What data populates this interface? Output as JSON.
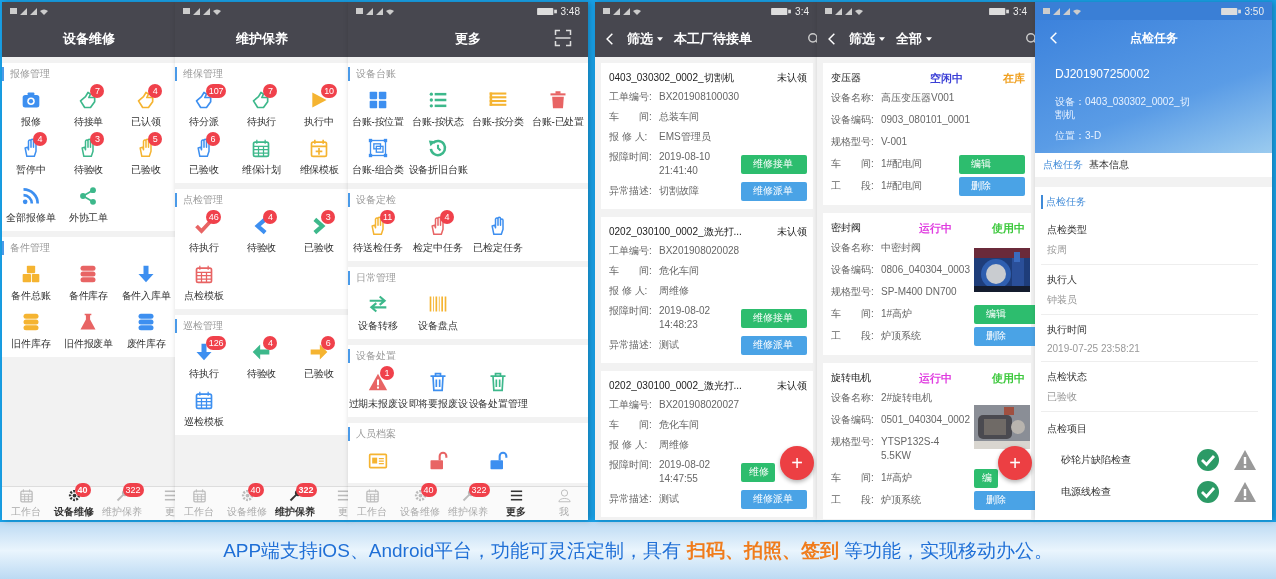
{
  "phones": [
    {
      "kind": "menu",
      "title": "设备维修",
      "sections": [
        {
          "title": "报修管理",
          "items": [
            {
              "label": "报修"
            },
            {
              "label": "待接单",
              "badge": "7"
            },
            {
              "label": "已认领",
              "badge": "4"
            },
            {
              "label": "暂停中",
              "badge": "4"
            },
            {
              "label": "待验收",
              "badge": "3"
            },
            {
              "label": "已验收",
              "badge": "5"
            },
            {
              "label": "全部报修单"
            },
            {
              "label": "外协工单"
            }
          ]
        },
        {
          "title": "备件管理",
          "items": [
            {
              "label": "备件总账"
            },
            {
              "label": "备件库存"
            },
            {
              "label": "备件入库单"
            },
            {
              "label": "旧件库存"
            },
            {
              "label": "旧件报废单"
            },
            {
              "label": "废件库存"
            }
          ]
        }
      ],
      "tabs": [
        {
          "label": "工作台",
          "selected": false
        },
        {
          "label": "设备维修",
          "badge": "40",
          "selected": true
        },
        {
          "label": "维护保养",
          "badge": "322",
          "selected": false
        },
        {
          "label": "更",
          "selected": false
        }
      ]
    },
    {
      "kind": "menu",
      "title": "维护保养",
      "sections": [
        {
          "title": "维保管理",
          "items": [
            {
              "label": "待分派",
              "badge": "107"
            },
            {
              "label": "待执行",
              "badge": "7"
            },
            {
              "label": "执行中",
              "badge": "10"
            },
            {
              "label": "已验收",
              "badge": "6"
            },
            {
              "label": "维保计划"
            },
            {
              "label": "维保模板"
            }
          ]
        },
        {
          "title": "点检管理",
          "items": [
            {
              "label": "待执行",
              "badge": "46"
            },
            {
              "label": "待验收",
              "badge": "4"
            },
            {
              "label": "已验收",
              "badge": "3"
            },
            {
              "label": "点检模板"
            }
          ]
        },
        {
          "title": "巡检管理",
          "items": [
            {
              "label": "待执行",
              "badge": "126"
            },
            {
              "label": "待验收",
              "badge": "4"
            },
            {
              "label": "已验收",
              "badge": "6"
            },
            {
              "label": "巡检模板"
            }
          ]
        }
      ],
      "tabs": [
        {
          "label": "工作台",
          "selected": false
        },
        {
          "label": "设备维修",
          "badge": "40",
          "selected": false
        },
        {
          "label": "维护保养",
          "badge": "322",
          "selected": true
        },
        {
          "label": "更",
          "selected": false
        }
      ]
    },
    {
      "kind": "menu",
      "status_time": "3:48",
      "title": "更多",
      "sections": [
        {
          "title": "设备台账",
          "items": [
            {
              "label": "台账-按位置"
            },
            {
              "label": "台账-按状态"
            },
            {
              "label": "台账-按分类"
            },
            {
              "label": "台账-已处置"
            },
            {
              "label": "台账-组合类"
            },
            {
              "label": "设备折旧台账"
            }
          ]
        },
        {
          "title": "设备定检",
          "items": [
            {
              "label": "待送检任务",
              "badge": "11"
            },
            {
              "label": "检定中任务",
              "badge": "4"
            },
            {
              "label": "已检定任务"
            }
          ]
        },
        {
          "title": "日常管理",
          "items": [
            {
              "label": "设备转移"
            },
            {
              "label": "设备盘点"
            }
          ]
        },
        {
          "title": "设备处置",
          "items": [
            {
              "label": "过期未报废设",
              "badge": "1"
            },
            {
              "label": "即将要报废设"
            },
            {
              "label": "设备处置管理"
            }
          ]
        },
        {
          "title": "人员档案"
        }
      ],
      "tabs": [
        {
          "label": "工作台",
          "selected": false
        },
        {
          "label": "设备维修",
          "badge": "40",
          "selected": false
        },
        {
          "label": "维护保养",
          "badge": "322",
          "selected": false
        },
        {
          "label": "更多",
          "selected": true
        },
        {
          "label": "我",
          "selected": false
        }
      ]
    },
    {
      "kind": "orders",
      "status_time": "3:4",
      "filter": "筛选",
      "title": "本工厂待接单",
      "fab": "+",
      "cards": [
        {
          "title": "0403_030302_0002_切割机",
          "status": "未认领",
          "fields": [
            {
              "label": "工单编号:",
              "value": "BX201908100030"
            },
            {
              "label": "车　　间:",
              "value": "总装车间"
            },
            {
              "label": "报 修 人:",
              "value": "EMS管理员"
            },
            {
              "label": "报障时间:",
              "value": "2019-08-10 21:41:40"
            },
            {
              "label": "异常描述:",
              "value": "切割故障"
            }
          ],
          "buttons": [
            "维修接单",
            "维修派单"
          ]
        },
        {
          "title": "0202_030100_0002_激光打...",
          "status": "未认领",
          "fields": [
            {
              "label": "工单编号:",
              "value": "BX201908020028"
            },
            {
              "label": "车　　间:",
              "value": "危化车间"
            },
            {
              "label": "报 修 人:",
              "value": "周维修"
            },
            {
              "label": "报障时间:",
              "value": "2019-08-02 14:48:23"
            },
            {
              "label": "异常描述:",
              "value": "测试"
            }
          ],
          "buttons": [
            "维修接单",
            "维修派单"
          ]
        },
        {
          "title": "0202_030100_0002_激光打...",
          "status": "未认领",
          "fields": [
            {
              "label": "工单编号:",
              "value": "BX201908020027"
            },
            {
              "label": "车　　间:",
              "value": "危化车间"
            },
            {
              "label": "报 修 人:",
              "value": "周维修"
            },
            {
              "label": "报障时间:",
              "value": "2019-08-02 14:47:55"
            },
            {
              "label": "异常描述:",
              "value": "测试"
            }
          ],
          "buttons": [
            "维修",
            "维修派单"
          ]
        }
      ]
    },
    {
      "kind": "equipment",
      "status_time": "3:4",
      "filter": "筛选",
      "scope": "全部",
      "fab": "+",
      "cards": [
        {
          "title": "变压器",
          "run_status": {
            "text": "空闲中",
            "color": "#3b3fd6"
          },
          "use_status": {
            "text": "在库",
            "color": "#f0a020"
          },
          "fields": [
            {
              "label": "设备名称:",
              "value": "高压变压器V001"
            },
            {
              "label": "设备编码:",
              "value": "0903_080101_0001"
            },
            {
              "label": "规格型号:",
              "value": "V-001"
            },
            {
              "label": "车　　间:",
              "value": "1#配电间"
            },
            {
              "label": "工　　段:",
              "value": "1#配电间"
            }
          ],
          "buttons": [
            "编辑",
            "删除"
          ]
        },
        {
          "title": "密封阀",
          "run_status": {
            "text": "运行中",
            "color": "#e03ce0"
          },
          "use_status": {
            "text": "使用中",
            "color": "#3cc83c"
          },
          "photo": {
            "kind": "picture"
          },
          "fields": [
            {
              "label": "设备名称:",
              "value": "中密封阀"
            },
            {
              "label": "设备编码:",
              "value": "0806_040304_0003"
            },
            {
              "label": "规格型号:",
              "value": "SP-M400 DN700"
            },
            {
              "label": "车　　间:",
              "value": "1#高炉"
            },
            {
              "label": "工　　段:",
              "value": "炉顶系统"
            }
          ],
          "buttons": [
            "编辑",
            "删除"
          ]
        },
        {
          "title": "旋转电机",
          "run_status": {
            "text": "运行中",
            "color": "#e03ce0"
          },
          "use_status": {
            "text": "使用中",
            "color": "#3cc83c"
          },
          "photo": {
            "kind": "picture"
          },
          "fields": [
            {
              "label": "设备名称:",
              "value": "2#旋转电机"
            },
            {
              "label": "设备编码:",
              "value": "0501_040304_0002"
            },
            {
              "label": "规格型号:",
              "value": "YTSP132S-4 5.5KW"
            },
            {
              "label": "车　　间:",
              "value": "1#高炉"
            },
            {
              "label": "工　　段:",
              "value": "炉顶系统"
            }
          ],
          "buttons": [
            "编",
            "删除"
          ]
        }
      ]
    },
    {
      "kind": "inspection",
      "status_time": "3:50",
      "title": "点检任务",
      "code": "DJ201907250002",
      "device": "设备：0403_030302_0002_切割机",
      "location": "位置：3-D",
      "tabs": [
        {
          "label": "点检任务",
          "selected": true
        },
        {
          "label": "基本信息",
          "selected": false
        }
      ],
      "section": "点检任务",
      "fields": [
        {
          "label": "点检类型",
          "value": "按周"
        },
        {
          "label": "执行人",
          "value": "钟装员"
        },
        {
          "label": "执行时间",
          "value": "2019-07-25 23:58:21"
        },
        {
          "label": "点检状态",
          "value": "已验收"
        }
      ],
      "items_title": "点检项目",
      "items": [
        {
          "label": "砂轮片缺陷检查",
          "checked": true
        },
        {
          "label": "电源线检查",
          "checked": true
        }
      ]
    }
  ],
  "banner": "APP端支持iOS、Android平台，功能可灵活定制，具有 **扫码、拍照、签到** 等功能，实现移动办公。"
}
